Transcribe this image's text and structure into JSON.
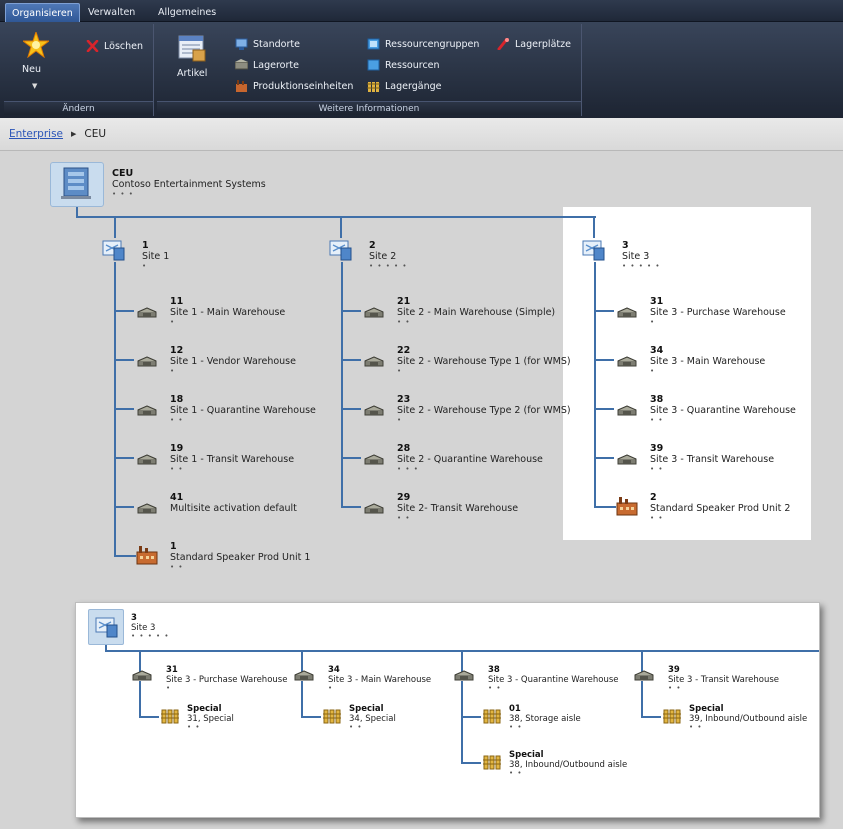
{
  "ribbon": {
    "tabs": [
      "Organisieren",
      "Verwalten",
      "Allgemeines"
    ],
    "active_tab": 0,
    "groups": {
      "aendern": {
        "label": "Ändern",
        "new_label": "Neu",
        "delete_label": "Löschen"
      },
      "weitere": {
        "label": "Weitere Informationen",
        "artikel_label": "Artikel",
        "buttons": {
          "standorte": "Standorte",
          "lagerorte": "Lagerorte",
          "produktionseinheiten": "Produktionseinheiten",
          "ressourcengruppen": "Ressourcengruppen",
          "ressourcen": "Ressourcen",
          "lagergaenge": "Lagergänge",
          "lagerplaetze": "Lagerplätze"
        }
      }
    }
  },
  "breadcrumb": {
    "root": "Enterprise",
    "current": "CEU"
  },
  "root_node": {
    "id": "CEU",
    "name": "Contoso Entertainment Systems",
    "dots": "• • •"
  },
  "sites": [
    {
      "id": "1",
      "name": "Site 1",
      "dots": "•",
      "children": [
        {
          "id": "11",
          "name": "Site 1 - Main Warehouse",
          "dots": "•"
        },
        {
          "id": "12",
          "name": "Site 1 - Vendor Warehouse",
          "dots": "•"
        },
        {
          "id": "18",
          "name": "Site 1 - Quarantine Warehouse",
          "dots": "• •"
        },
        {
          "id": "19",
          "name": "Site 1 - Transit Warehouse",
          "dots": "• •"
        },
        {
          "id": "41",
          "name": "Multisite activation default",
          "dots": ""
        },
        {
          "id": "1",
          "name": "Standard Speaker Prod Unit 1",
          "dots": "• •"
        }
      ]
    },
    {
      "id": "2",
      "name": "Site 2",
      "dots": "• • • • •",
      "children": [
        {
          "id": "21",
          "name": "Site 2 - Main Warehouse (Simple)",
          "dots": "• •"
        },
        {
          "id": "22",
          "name": "Site 2 - Warehouse Type 1 (for WMS)",
          "dots": "•"
        },
        {
          "id": "23",
          "name": "Site 2 - Warehouse Type 2 (for WMS)",
          "dots": "•"
        },
        {
          "id": "28",
          "name": "Site 2 - Quarantine Warehouse",
          "dots": "• • •"
        },
        {
          "id": "29",
          "name": "Site 2- Transit Warehouse",
          "dots": "• •"
        }
      ]
    },
    {
      "id": "3",
      "name": "Site 3",
      "dots": "• • • • •",
      "children": [
        {
          "id": "31",
          "name": "Site 3 - Purchase Warehouse",
          "dots": "•"
        },
        {
          "id": "34",
          "name": "Site 3 - Main Warehouse",
          "dots": "•"
        },
        {
          "id": "38",
          "name": "Site 3 - Quarantine Warehouse",
          "dots": "• •"
        },
        {
          "id": "39",
          "name": "Site 3 - Transit Warehouse",
          "dots": "• •"
        },
        {
          "id": "2",
          "name": "Standard Speaker Prod Unit 2",
          "dots": "• •"
        }
      ]
    }
  ],
  "detail": {
    "site": {
      "id": "3",
      "name": "Site 3",
      "dots": "• • • • •"
    },
    "warehouses": [
      {
        "id": "31",
        "name": "Site 3 - Purchase Warehouse",
        "dots": "•",
        "aisles": [
          {
            "id": "Special",
            "name": "31, Special",
            "dots": "• •"
          }
        ]
      },
      {
        "id": "34",
        "name": "Site 3 - Main Warehouse",
        "dots": "•",
        "aisles": [
          {
            "id": "Special",
            "name": "34, Special",
            "dots": "• •"
          }
        ]
      },
      {
        "id": "38",
        "name": "Site 3 - Quarantine Warehouse",
        "dots": "• •",
        "aisles": [
          {
            "id": "01",
            "name": "38, Storage aisle",
            "dots": "• •"
          },
          {
            "id": "Special",
            "name": "38, Inbound/Outbound aisle",
            "dots": "• •"
          }
        ]
      },
      {
        "id": "39",
        "name": "Site 3 - Transit Warehouse",
        "dots": "• •",
        "aisles": [
          {
            "id": "Special",
            "name": "39, Inbound/Outbound aisle",
            "dots": "• •"
          }
        ]
      }
    ]
  },
  "colors": {
    "connector": "#3f6fa8",
    "ribbon_dark": "#252e3e",
    "link": "#2b55b8"
  }
}
